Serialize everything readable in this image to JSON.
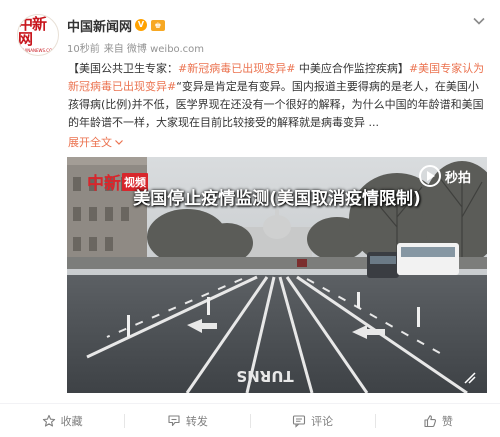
{
  "post": {
    "author": {
      "name": "中国新闻网",
      "avatar_logo_text": "中新网",
      "avatar_logo_subtext": "CHINANEWS.COM",
      "verified_icon": "verified-v-icon",
      "level_icon": "level-badge-icon",
      "level_text": "♚"
    },
    "meta": {
      "time": "10秒前",
      "source": "来自 微博 weibo.com"
    },
    "text_segments": [
      {
        "text": "【美国公共卫生专家：",
        "type": "plain"
      },
      {
        "text": "#新冠病毒已出现变异#",
        "type": "hashtag"
      },
      {
        "text": " 中美应合作监控疾病】",
        "type": "plain"
      },
      {
        "text": "#美国专家认为新冠病毒已出现变异#",
        "type": "hashtag"
      },
      {
        "text": "“变异是肯定是有变异。国内报道主要得病的是老人，在美国小孩得病(比例)并不低，医学界现在还没有一个很好的解释，为什么中国的年龄谱和美国的年龄谱不一样，大家现在目前比较接受的解释就是病毒变异 ...",
        "type": "plain"
      }
    ],
    "expand_label": "展开全文",
    "video": {
      "watermark_red": "中新",
      "watermark_box": "视频",
      "title": "美国停止疫情监测(美国取消疫情限制)",
      "brand": "秒拍",
      "road_marking": "TURNS"
    }
  },
  "footer": {
    "actions": [
      {
        "label": "收藏",
        "icon": "star-icon"
      },
      {
        "label": "转发",
        "icon": "repost-icon"
      },
      {
        "label": "评论",
        "icon": "comment-icon"
      },
      {
        "label": "赞",
        "icon": "thumbs-up-icon"
      }
    ]
  },
  "colors": {
    "hashtag": "#eb7350",
    "logo_red": "#c8161d",
    "meta_gray": "#939393",
    "verified_orange": "#ffa200"
  }
}
